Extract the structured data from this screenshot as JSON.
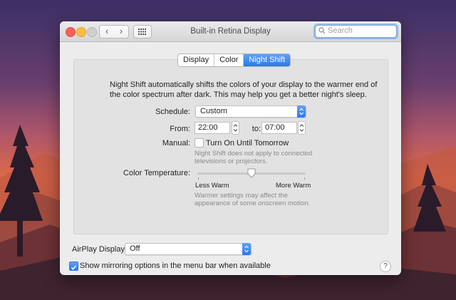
{
  "window": {
    "title": "Built-in Retina Display"
  },
  "toolbar": {
    "back_label": "‹",
    "forward_label": "›",
    "search_placeholder": "Search"
  },
  "tabs": [
    {
      "label": "Display",
      "active": false
    },
    {
      "label": "Color",
      "active": false
    },
    {
      "label": "Night Shift",
      "active": true
    }
  ],
  "night_shift": {
    "description": "Night Shift automatically shifts the colors of your display to the warmer end of the color spectrum after dark. This may help you get a better night's sleep.",
    "schedule_label": "Schedule:",
    "schedule_value": "Custom",
    "from_label": "From:",
    "from_value": "22:00",
    "to_label": "to:",
    "to_value": "07:00",
    "manual_label": "Manual:",
    "manual_checkbox_label": "Turn On Until Tomorrow",
    "manual_checked": false,
    "manual_note_line1": "Night Shift does not apply to connected",
    "manual_note_line2": "televisions or projectors.",
    "temperature_label": "Color Temperature:",
    "temperature_level": 0.5,
    "less_warm_label": "Less Warm",
    "more_warm_label": "More Warm",
    "temperature_note_line1": "Warmer settings may affect the",
    "temperature_note_line2": "appearance of some onscreen motion."
  },
  "footer": {
    "airplay_label": "AirPlay Display:",
    "airplay_value": "Off",
    "mirroring_label": "Show mirroring options in the menu bar when available",
    "mirroring_checked": true,
    "help_label": "?"
  },
  "colors": {
    "accent": "#2a78ef"
  }
}
